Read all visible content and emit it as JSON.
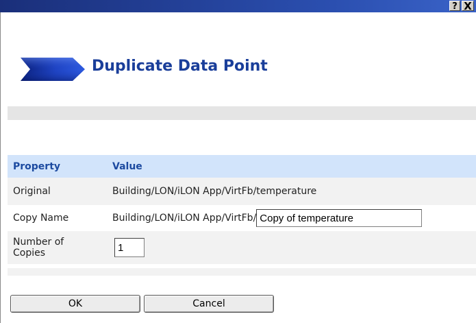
{
  "window": {
    "help_label": "?",
    "close_label": "X"
  },
  "header": {
    "title": "Duplicate Data Point",
    "icon": "chevron-arrow-icon"
  },
  "table": {
    "col_property": "Property",
    "col_value": "Value",
    "rows": {
      "original": {
        "label": "Original",
        "value": "Building/LON/iLON App/VirtFb/temperature"
      },
      "copy_name": {
        "label": "Copy Name",
        "prefix": "Building/LON/iLON App/VirtFb/",
        "input_value": "Copy of temperature"
      },
      "copies": {
        "label_line1": "Number of",
        "label_line2": "Copies",
        "input_value": "1"
      }
    }
  },
  "buttons": {
    "ok": "OK",
    "cancel": "Cancel"
  },
  "colors": {
    "title": "#1a3e9a",
    "header_bg": "#d2e4fb",
    "row_alt": "#f2f2f2",
    "titlebar": "#2b4fb0"
  }
}
